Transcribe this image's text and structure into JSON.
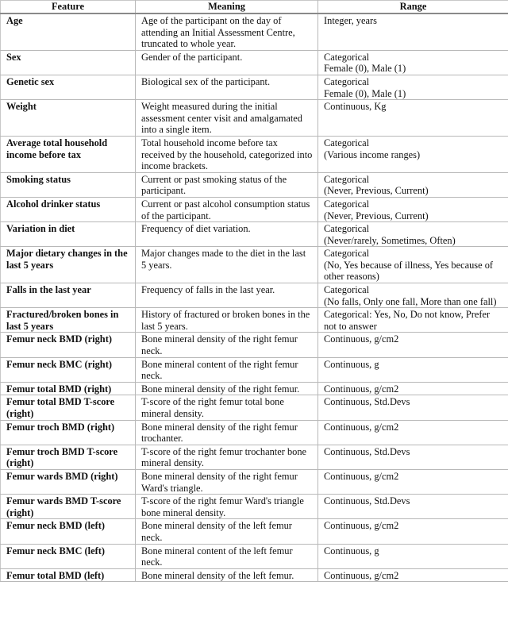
{
  "table": {
    "headers": [
      "Feature",
      "Meaning",
      "Range"
    ],
    "rows": [
      {
        "feature": "Age",
        "meaning": "Age of the participant on the day of attending an Initial Assessment Centre, truncated to whole year.",
        "range": "Integer, years"
      },
      {
        "feature": "Sex",
        "meaning": "Gender of the participant.",
        "range": "Categorical\nFemale (0), Male (1)"
      },
      {
        "feature": "Genetic sex",
        "meaning": "Biological sex of the participant.",
        "range": "Categorical\nFemale (0), Male (1)"
      },
      {
        "feature": "Weight",
        "meaning": "Weight measured during the initial assessment center visit and amalgamated into a single item.",
        "range": "Continuous, Kg"
      },
      {
        "feature": "Average total household income before tax",
        "meaning": "Total household income before tax received by the household, categorized into income brackets.",
        "range": "Categorical\n(Various income ranges)"
      },
      {
        "feature": "Smoking status",
        "meaning": "Current or past smoking status of the participant.",
        "range": "Categorical\n(Never, Previous, Current)"
      },
      {
        "feature": "Alcohol drinker status",
        "meaning": "Current or past alcohol consumption status of the participant.",
        "range": "Categorical\n(Never, Previous, Current)"
      },
      {
        "feature": "Variation in diet",
        "meaning": "Frequency of diet variation.",
        "range": "Categorical\n(Never/rarely, Sometimes, Often)"
      },
      {
        "feature": "Major dietary changes in the last 5 years",
        "meaning": "Major changes made to the diet in the last 5 years.",
        "range": "Categorical\n(No, Yes because of illness, Yes because of other reasons)"
      },
      {
        "feature": "Falls in the last year",
        "meaning": "Frequency of falls in the last year.",
        "range": "Categorical\n(No falls, Only one fall, More than one fall)"
      },
      {
        "feature": "Fractured/broken bones in last 5 years",
        "meaning": "History of fractured or broken bones in the last 5 years.",
        "range": "Categorical: Yes, No, Do not know, Prefer not to answer"
      },
      {
        "feature": "Femur neck BMD (right)",
        "meaning": "Bone mineral density of the right femur neck.",
        "range": "Continuous, g/cm2"
      },
      {
        "feature": "Femur neck BMC (right)",
        "meaning": "Bone mineral content of the right femur neck.",
        "range": "Continuous, g"
      },
      {
        "feature": "Femur total BMD (right)",
        "meaning": "Bone mineral density of the right femur.",
        "range": "Continuous, g/cm2"
      },
      {
        "feature": "Femur total BMD T-score (right)",
        "meaning": "T-score of the right femur total bone mineral density.",
        "range": "Continuous, Std.Devs"
      },
      {
        "feature": "Femur troch BMD (right)",
        "meaning": "Bone mineral density of the right femur trochanter.",
        "range": "Continuous, g/cm2"
      },
      {
        "feature": "Femur troch BMD T-score (right)",
        "meaning": "T-score of the right femur trochanter bone mineral density.",
        "range": "Continuous, Std.Devs"
      },
      {
        "feature": "Femur wards BMD (right)",
        "meaning": "Bone mineral density of the right femur Ward's triangle.",
        "range": "Continuous, g/cm2"
      },
      {
        "feature": "Femur wards BMD T-score (right)",
        "meaning": "T-score of the right femur Ward's triangle bone mineral density.",
        "range": "Continuous, Std.Devs"
      },
      {
        "feature": "Femur neck BMD (left)",
        "meaning": "Bone mineral density of the left femur neck.",
        "range": "Continuous, g/cm2"
      },
      {
        "feature": "Femur neck BMC (left)",
        "meaning": "Bone mineral content of the left femur neck.",
        "range": "Continuous, g"
      },
      {
        "feature": "Femur total BMD (left)",
        "meaning": "Bone mineral density of the left femur.",
        "range": "Continuous, g/cm2"
      }
    ]
  }
}
